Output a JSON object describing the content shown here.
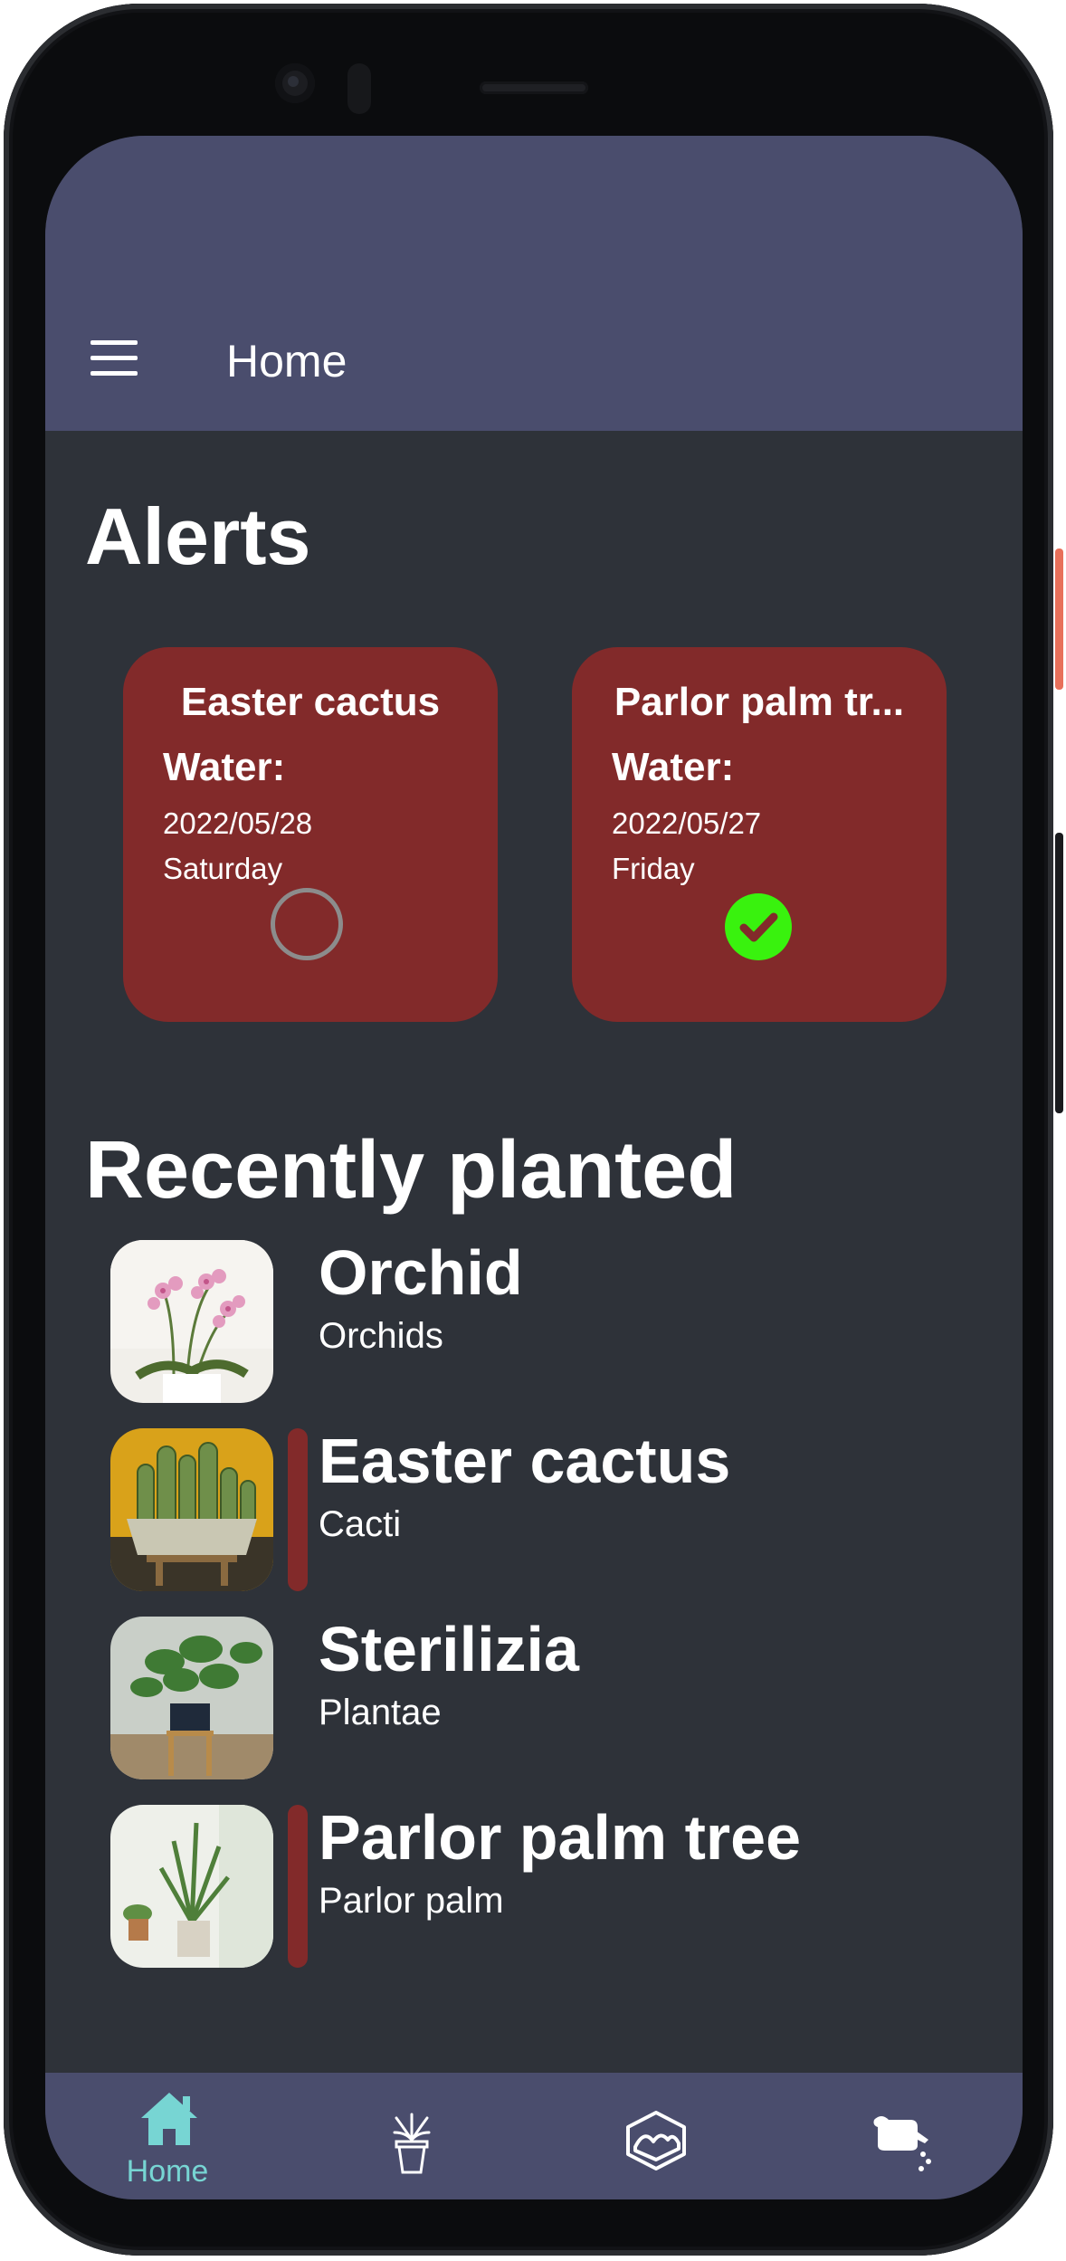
{
  "app_bar": {
    "title": "Home",
    "menu_icon": "hamburger-menu-icon",
    "background": "#4a4d6d"
  },
  "alerts": {
    "title": "Alerts",
    "cards": [
      {
        "plant": "Easter cactus",
        "task": "Water:",
        "date": "2022/05/28",
        "day": "Saturday",
        "done": false
      },
      {
        "plant": "Parlor palm tr...",
        "task": "Water:",
        "date": "2022/05/27",
        "day": "Friday",
        "done": true
      }
    ],
    "card_color": "#822a2a",
    "done_color": "#39f20e"
  },
  "recent": {
    "title": "Recently planted",
    "items": [
      {
        "name": "Orchid",
        "species": "Orchids",
        "needs_attention": false
      },
      {
        "name": "Easter cactus",
        "species": "Cacti",
        "needs_attention": true
      },
      {
        "name": "Sterilizia",
        "species": "Plantae",
        "needs_attention": false
      },
      {
        "name": "Parlor palm tree",
        "species": "Parlor palm",
        "needs_attention": true
      }
    ]
  },
  "bottom_nav": {
    "items": [
      {
        "label": "Home",
        "icon": "home-icon",
        "active": true
      },
      {
        "label": "",
        "icon": "potted-plant-icon",
        "active": false
      },
      {
        "label": "",
        "icon": "garden-box-icon",
        "active": false
      },
      {
        "label": "",
        "icon": "watering-can-icon",
        "active": false
      }
    ],
    "active_color": "#77d5d3"
  },
  "system_nav": {
    "icons": [
      "back-icon",
      "home-circle-icon",
      "recents-square-icon"
    ]
  }
}
